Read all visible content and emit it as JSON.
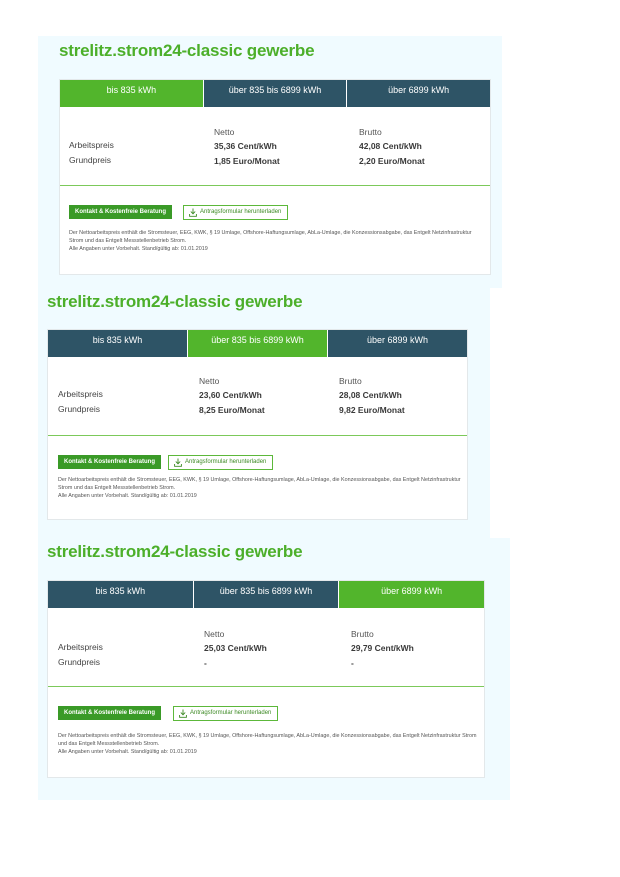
{
  "cards": [
    {
      "title": "strelitz.strom24-classic gewerbe",
      "tabs": [
        "bis 835 kWh",
        "über 835 bis 6899 kWh",
        "über 6899 kWh"
      ],
      "active_tab": 0,
      "prices": {
        "netto_header": "Netto",
        "brutto_header": "Brutto",
        "arbeitspreis_label": "Arbeitspreis",
        "grundpreis_label": "Grundpreis",
        "arbeitspreis_netto": "35,36 Cent/kWh",
        "arbeitspreis_brutto": "42,08 Cent/kWh",
        "grundpreis_netto": "1,85 Euro/Monat",
        "grundpreis_brutto": "2,20 Euro/Monat"
      },
      "contact_button": "Kontakt & Kostenfreie Beratung",
      "download_button": "Antragsformular herunterladen",
      "note_line1": "Der Nettoarbeitspreis enthält die Stromsteuer, EEG, KWK, § 19 Umlage, Offshore-Haftungsumlage, AbLa-Umlage, die Konzessionsabgabe, das Entgelt Netzinfrastruktur Strom und das Entgelt Messstellenbetrieb Strom.",
      "note_line2": "Alle Angaben unter Vorbehalt. Stand/gültig ab: 01.01.2019"
    },
    {
      "title": "strelitz.strom24-classic gewerbe",
      "tabs": [
        "bis 835 kWh",
        "über 835 bis 6899 kWh",
        "über 6899 kWh"
      ],
      "active_tab": 1,
      "prices": {
        "netto_header": "Netto",
        "brutto_header": "Brutto",
        "arbeitspreis_label": "Arbeitspreis",
        "grundpreis_label": "Grundpreis",
        "arbeitspreis_netto": "23,60 Cent/kWh",
        "arbeitspreis_brutto": "28,08 Cent/kWh",
        "grundpreis_netto": "8,25 Euro/Monat",
        "grundpreis_brutto": "9,82 Euro/Monat"
      },
      "contact_button": "Kontakt & Kostenfreie Beratung",
      "download_button": "Antragsformular herunterladen",
      "note_line1": "Der Nettoarbeitspreis enthält die Stromsteuer, EEG, KWK, § 19 Umlage, Offshore-Haftungsumlage, AbLa-Umlage, die Konzessionsabgabe, das Entgelt Netzinfrastruktur Strom und das Entgelt Messstellenbetrieb Strom.",
      "note_line2": "Alle Angaben unter Vorbehalt. Stand/gültig ab: 01.01.2019"
    },
    {
      "title": "strelitz.strom24-classic gewerbe",
      "tabs": [
        "bis 835 kWh",
        "über 835 bis 6899 kWh",
        "über 6899 kWh"
      ],
      "active_tab": 2,
      "prices": {
        "netto_header": "Netto",
        "brutto_header": "Brutto",
        "arbeitspreis_label": "Arbeitspreis",
        "grundpreis_label": "Grundpreis",
        "arbeitspreis_netto": "25,03 Cent/kWh",
        "arbeitspreis_brutto": "29,79 Cent/kWh",
        "grundpreis_netto": "-",
        "grundpreis_brutto": "-"
      },
      "contact_button": "Kontakt & Kostenfreie Beratung",
      "download_button": "Antragsformular herunterladen",
      "note_line1": "Der Nettoarbeitspreis enthält die Stromsteuer, EEG, KWK, § 19 Umlage, Offshore-Haftungsumlage, AbLa-Umlage, die Konzessionsabgabe, das Entgelt Netzinfrastruktur Strom und das Entgelt Messstellenbetrieb Strom.",
      "note_line2": "Alle Angaben unter Vorbehalt. Stand/gültig ab: 01.01.2019"
    }
  ],
  "colors": {
    "brand_green": "#52b52c",
    "tab_dark": "#2e5466",
    "title_green": "#4caf2a",
    "background_tint": "#f0fbff"
  }
}
